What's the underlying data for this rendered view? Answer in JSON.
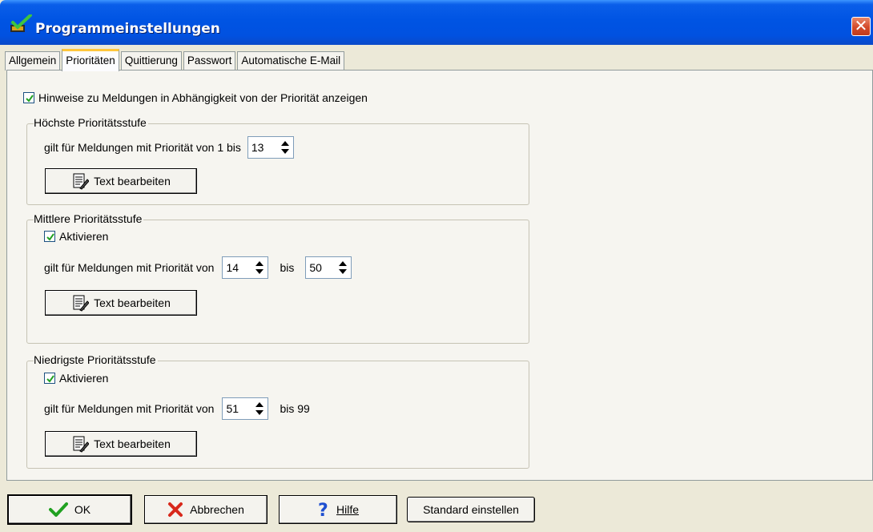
{
  "window": {
    "title": "Programmeinstellungen"
  },
  "tabs": [
    {
      "label": "Allgemein",
      "active": false
    },
    {
      "label": "Prioritäten",
      "active": true
    },
    {
      "label": "Quittierung",
      "active": false
    },
    {
      "label": "Passwort",
      "active": false
    },
    {
      "label": "Automatische E-Mail",
      "active": false
    }
  ],
  "main": {
    "show_hints": {
      "label": "Hinweise zu Meldungen in Abhängigkeit von der Priorität anzeigen",
      "checked": true
    },
    "highest": {
      "legend": "Höchste Prioritätsstufe",
      "range_label": "gilt für Meldungen mit Priorität von 1 bis",
      "to_value": "13",
      "edit_button": "Text bearbeiten"
    },
    "medium": {
      "legend": "Mittlere Prioritätsstufe",
      "activate_label": "Aktivieren",
      "activate_checked": true,
      "range_label": "gilt für Meldungen mit Priorität von",
      "from_value": "14",
      "to_label": "bis",
      "to_value": "50",
      "edit_button": "Text bearbeiten"
    },
    "lowest": {
      "legend": "Niedrigste Prioritätsstufe",
      "activate_label": "Aktivieren",
      "activate_checked": true,
      "range_label": "gilt für Meldungen mit Priorität von",
      "from_value": "51",
      "to_label": "bis 99",
      "edit_button": "Text bearbeiten"
    }
  },
  "footer": {
    "ok_label": "OK",
    "cancel_label": "Abbrechen",
    "help_label": "Hilfe",
    "defaults_label": "Standard einstellen"
  },
  "colors": {
    "titlebar": "#0054e3",
    "tab_highlight": "#ffc73c",
    "check_green": "#21a121",
    "cancel_red": "#d8281b",
    "help_blue": "#1e4fd0"
  }
}
